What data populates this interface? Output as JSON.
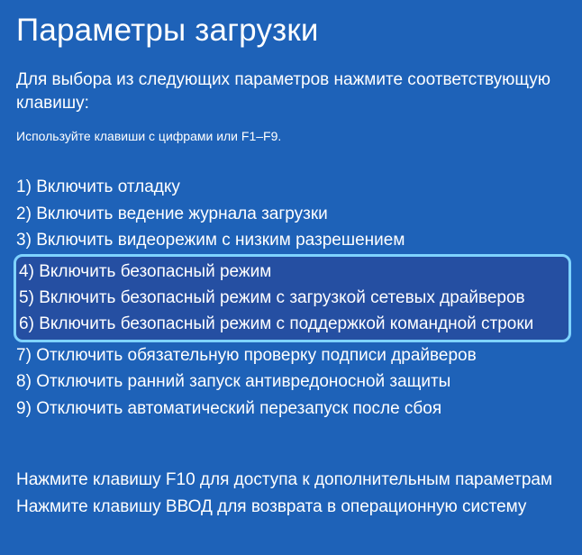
{
  "title": "Параметры загрузки",
  "subtitle": "Для выбора из следующих параметров нажмите соответствующую клавишу:",
  "hint": "Используйте клавиши с цифрами или F1–F9.",
  "options": [
    {
      "num": "1)",
      "label": "Включить отладку"
    },
    {
      "num": "2)",
      "label": "Включить ведение журнала загрузки"
    },
    {
      "num": "3)",
      "label": "Включить видеорежим с низким разрешением"
    },
    {
      "num": "4)",
      "label": "Включить безопасный режим"
    },
    {
      "num": "5)",
      "label": "Включить безопасный режим с загрузкой сетевых драйверов"
    },
    {
      "num": "6)",
      "label": "Включить безопасный режим с поддержкой командной строки"
    },
    {
      "num": "7)",
      "label": "Отключить обязательную проверку подписи драйверов"
    },
    {
      "num": "8)",
      "label": "Отключить ранний запуск антивредоносной защиты"
    },
    {
      "num": "9)",
      "label": "Отключить автоматический перезапуск после сбоя"
    }
  ],
  "footer": {
    "line1": "Нажмите клавишу F10 для доступа к дополнительным параметрам",
    "line2": "Нажмите клавишу ВВОД для возврата в операционную систему"
  },
  "highlight_range": [
    3,
    5
  ]
}
